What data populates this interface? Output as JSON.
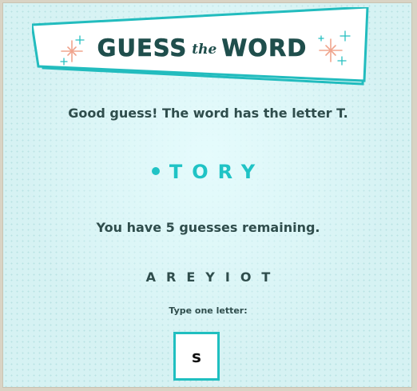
{
  "header": {
    "title_left": "GUESS",
    "title_middle": "the",
    "title_right": "WORD"
  },
  "game": {
    "feedback_message": "Good guess! The word has the letter T.",
    "word_pattern": "TORY",
    "remaining_message": "You have 5 guesses remaining.",
    "guessed_letters": "AREYIOT",
    "input_label": "Type one letter:",
    "input_value": "s"
  },
  "colors": {
    "accent": "#1fc3c5",
    "title": "#1f4e4c",
    "text": "#2f4d4c",
    "sparkle_coral": "#f0a58e",
    "sparkle_teal": "#25bfc1"
  }
}
